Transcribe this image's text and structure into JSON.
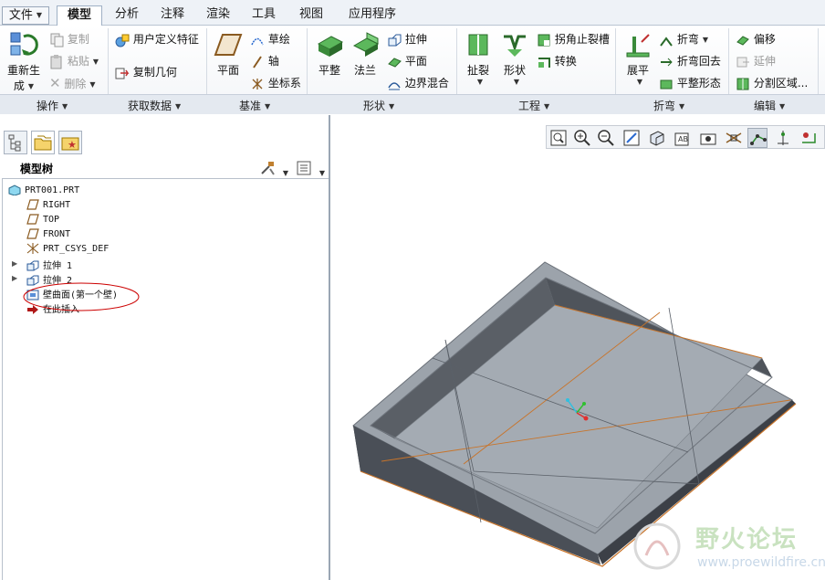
{
  "menu": {
    "file": "文件",
    "tabs": [
      "模型",
      "分析",
      "注释",
      "渲染",
      "工具",
      "视图",
      "应用程序"
    ],
    "active_tab": "模型"
  },
  "ribbon": {
    "operations": {
      "regenerate_line1": "重新生",
      "regenerate_line2": "成",
      "copy": "复制",
      "paste": "粘贴",
      "delete": "删除"
    },
    "get_data": {
      "udf": "用户定义特征",
      "copy_geometry": "复制几何"
    },
    "datum": {
      "plane": "平面",
      "sketch": "草绘",
      "axis": "轴",
      "csys": "坐标系"
    },
    "shapes": {
      "planar": "平整",
      "flange": "法兰",
      "extrude": "拉伸",
      "flat": "平面",
      "boundary_blend": "边界混合"
    },
    "engineering": {
      "rip": "扯裂",
      "form": "形状",
      "corner_relief": "拐角止裂槽",
      "convert": "转换"
    },
    "bends": {
      "unbend": "展平",
      "bend": "折弯",
      "bend_back": "折弯回去",
      "flatten": "平整形态"
    },
    "editing": {
      "offset": "偏移",
      "extend": "延伸",
      "split_area": "分割区域..."
    },
    "groups": [
      "操作",
      "获取数据",
      "基准",
      "形状",
      "工程",
      "折弯",
      "编辑"
    ]
  },
  "model_tree": {
    "title": "模型树",
    "items": [
      {
        "label": "PRT001.PRT"
      },
      {
        "label": "RIGHT"
      },
      {
        "label": "TOP"
      },
      {
        "label": "FRONT"
      },
      {
        "label": "PRT_CSYS_DEF"
      },
      {
        "label": "拉伸 1"
      },
      {
        "label": "拉伸 2"
      },
      {
        "label": "壁曲面(第一个壁)"
      },
      {
        "label": "在此插入"
      }
    ],
    "highlight_color": "#cc0000"
  },
  "watermark": {
    "name": "野火论坛",
    "url": "www.proewildfire.cn"
  },
  "colors": {
    "model_top": "#9ca3ab",
    "model_side": "#4c5159",
    "edge": "#c8742a",
    "accent": "#3a7bd5"
  }
}
